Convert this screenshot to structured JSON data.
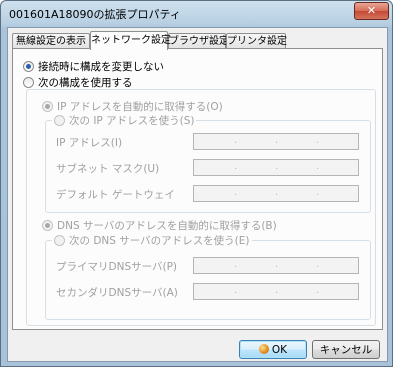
{
  "window": {
    "title": "001601A18090の拡張プロパティ",
    "close_glyph": "✕"
  },
  "tabs": [
    {
      "label": "無線設定の表示"
    },
    {
      "label": "ネットワーク設定"
    },
    {
      "label": "ブラウザ設定"
    },
    {
      "label": "プリンタ設定"
    }
  ],
  "options": {
    "no_change": "接続時に構成を変更しない",
    "use_following": "次の構成を使用する"
  },
  "ip": {
    "auto": "IP アドレスを自動的に取得する(O)",
    "manual": "次の IP アドレスを使う(S)",
    "address_label": "IP アドレス(I)",
    "subnet_label": "サブネット マスク(U)",
    "gateway_label": "デフォルト ゲートウェイ"
  },
  "dns": {
    "auto": "DNS サーバのアドレスを自動的に取得する(B)",
    "manual": "次の DNS サーバのアドレスを使う(E)",
    "primary_label": "プライマリDNSサーバ(P)",
    "secondary_label": "セカンダリDNSサーバ(A)"
  },
  "ip_dot": ".",
  "buttons": {
    "ok": "OK",
    "cancel": "キャンセル"
  },
  "colors": {
    "radio_selected": "#2d5fa8",
    "disabled_text": "#a0a0a0"
  }
}
